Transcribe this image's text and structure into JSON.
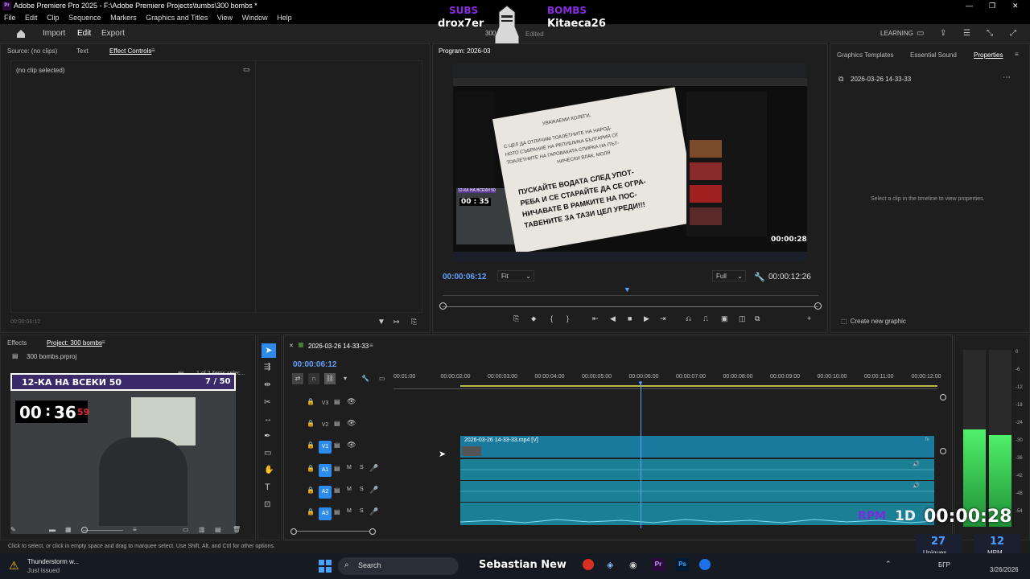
{
  "app": {
    "logo": "Pr",
    "title": "Adobe Premiere Pro 2025 - F:\\Adobe Premiere Projects\\tumbs\\300 bombs *"
  },
  "menu": [
    "File",
    "Edit",
    "Clip",
    "Sequence",
    "Markers",
    "Graphics and Titles",
    "View",
    "Window",
    "Help"
  ],
  "workspace": {
    "tabs": [
      "Import",
      "Edit",
      "Export"
    ],
    "active": "Edit",
    "learning": "LEARNING"
  },
  "stream_overlay_top": {
    "subs_label": "SUBS",
    "bombs_label": "BOMBS",
    "user_left": "drox7er",
    "user_right": "Kitaeca26",
    "count": "941",
    "edited_partial": "Edited",
    "partial_300": "300"
  },
  "source_panel": {
    "tabs": [
      "Source: (no clips)",
      "Text",
      "Effect Controls"
    ],
    "active": "Effect Controls",
    "no_clip": "(no clip selected)",
    "timecode": "00:00:06:12"
  },
  "program": {
    "label": "Program: 2026-03",
    "timecode": "00:00:06:12",
    "fit": "Fit",
    "full": "Full",
    "duration": "00:00:12:26",
    "video": {
      "paper_lines": [
        "УВАЖАЕМИ КОЛЕГИ,",
        "С ЦЕЛ ДА ОТЛИЧИМ ТОАЛЕТНИТЕ НА НАРОД-",
        "НОТО СЪБРАНИЕ НА РЕПУБЛИКА БЪЛГАРИЯ ОТ",
        "ТОАЛЕТНИТЕ НА ГАРОВАКАТА СПИРКА НА ПЪТ-",
        "НИЧЕСКИ ВЛАК, МОЛЯ",
        "ПУСКАЙТЕ ВОДАТА СЛЕД УПОТ-",
        "РЕБА И СЕ СТАРАЙТЕ ДА СЕ ОГРА-",
        "НИЧАВАТЕ В РАМКИТЕ НА ПОС-",
        "ТАВЕНИТЕ ЗА ТАЗИ ЦЕЛ УРЕДИ!!!"
      ],
      "timer": "00 : 35",
      "rpm_clock": "00:00:28",
      "banner": "12-КА НА ВСЕКИ 50"
    }
  },
  "right_panel": {
    "tabs": [
      "Graphics Templates",
      "Essential Sound",
      "Properties"
    ],
    "active": "Properties",
    "item": "2026-03-26 14-33-33",
    "hint": "Select a clip in the timeline to view properties.",
    "create_graphic": "Create new graphic"
  },
  "project_panel": {
    "tabs": [
      "Effects",
      "Project: 300 bombs"
    ],
    "active": "Project: 300 bombs",
    "file": "300 bombs.prproj",
    "items_sel": "1 of 2 items selec...",
    "thumb": {
      "banner": "12-КА НА ВСЕКИ 50",
      "counter": "7 / 50",
      "timer_mm": "00",
      "timer_ss": "36",
      "timer_red": "59"
    }
  },
  "timeline": {
    "sequence": "2026-03-26 14-33-33",
    "timecode": "00:00:06:12",
    "ruler": [
      "00:01:00",
      "00:00:02:00",
      "00:00:03:00",
      "00:00:04:00",
      "00:00:05:00",
      "00:00:06:00",
      "00:00:07:00",
      "00:00:08:00",
      "00:00:09:00",
      "00:00:10:00",
      "00:00:11:00",
      "00:00:12:00"
    ],
    "video_tracks": [
      "V3",
      "V2",
      "V1"
    ],
    "audio_tracks": [
      "A1",
      "A2",
      "A3"
    ],
    "clip_name": "2026-03-26 14-33-33.mp4 [V]",
    "m": "M",
    "s": "S"
  },
  "meter": {
    "labels": [
      "0",
      "-6",
      "-12",
      "-18",
      "-24",
      "-30",
      "-36",
      "-42",
      "-48",
      "-54"
    ],
    "levels": [
      0.55,
      0.52
    ]
  },
  "status": {
    "hint": "Click to select, or click in empty space and drag to marquee select. Use Shift, Alt, and Ctrl for other options."
  },
  "stream_overlay_bottom": {
    "rpm": "RPM",
    "one_d": "1D",
    "clock": "00:00:28",
    "uniques": "27",
    "uniques_label": "Uniques",
    "mpm": "12",
    "mpm_label": "MPM"
  },
  "taskbar": {
    "weather_title": "Thunderstorm w...",
    "weather_sub": "Just issued",
    "search": "Search",
    "user_name": "Sebastian New",
    "lang": "БГР",
    "date": "3/26/2026"
  },
  "colors": {
    "accent": "#2d8ceb",
    "timecode": "#5fa0ff",
    "clip": "#1a7a9e",
    "meter_green": "#3ddc5c"
  }
}
